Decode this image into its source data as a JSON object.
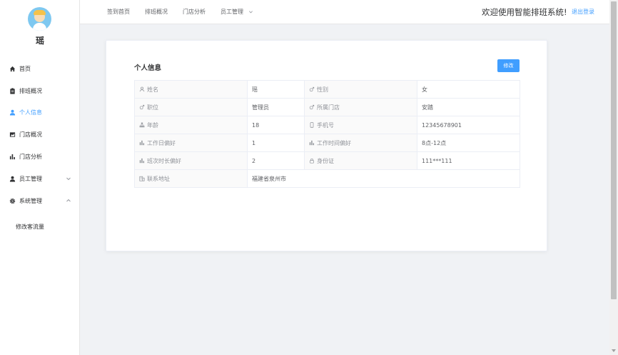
{
  "user": {
    "name": "瑶"
  },
  "sidebar": {
    "items": [
      {
        "label": "首页",
        "icon": "home-icon"
      },
      {
        "label": "排班概况",
        "icon": "clipboard-icon"
      },
      {
        "label": "个人信息",
        "icon": "user-icon"
      },
      {
        "label": "门店概况",
        "icon": "chart-area-icon"
      },
      {
        "label": "门店分析",
        "icon": "bar-chart-icon"
      },
      {
        "label": "员工管理",
        "icon": "users-icon",
        "arrow": "chevron-down-icon"
      },
      {
        "label": "系统管理",
        "icon": "gear-icon",
        "arrow": "chevron-up-icon"
      }
    ],
    "subitems": [
      {
        "label": "修改客流量"
      }
    ],
    "active_color": "#409eff"
  },
  "topnav": {
    "items": [
      "签到首页",
      "排班概况",
      "门店分析",
      "员工管理"
    ],
    "welcome": "欢迎使用智能排班系统!",
    "logout": "退出登录"
  },
  "card": {
    "title": "个人信息",
    "edit_label": "修改",
    "rows": [
      [
        {
          "label": "姓名",
          "icon": "user-outline-icon",
          "value": "瑶"
        },
        {
          "label": "性别",
          "icon": "male-icon",
          "value": "女"
        }
      ],
      [
        {
          "label": "职位",
          "icon": "male-icon",
          "value": "管理员"
        },
        {
          "label": "所属门店",
          "icon": "male-icon",
          "value": "安踏"
        }
      ],
      [
        {
          "label": "年龄",
          "icon": "sitemap-icon",
          "value": "18"
        },
        {
          "label": "手机号",
          "icon": "mobile-icon",
          "value": "12345678901"
        }
      ],
      [
        {
          "label": "工作日偏好",
          "icon": "bar-chart-icon",
          "value": "1"
        },
        {
          "label": "工作时间偏好",
          "icon": "bar-chart-icon",
          "value": "8点-12点"
        }
      ],
      [
        {
          "label": "班次时长偏好",
          "icon": "bar-chart-icon",
          "value": "2"
        },
        {
          "label": "身份证",
          "icon": "lock-icon",
          "value": "111***111"
        }
      ],
      [
        {
          "label": "联系地址",
          "icon": "office-building-icon",
          "value": "福建省泉州市"
        }
      ]
    ]
  },
  "colors": {
    "primary": "#409eff",
    "background": "#f0f2f5"
  }
}
